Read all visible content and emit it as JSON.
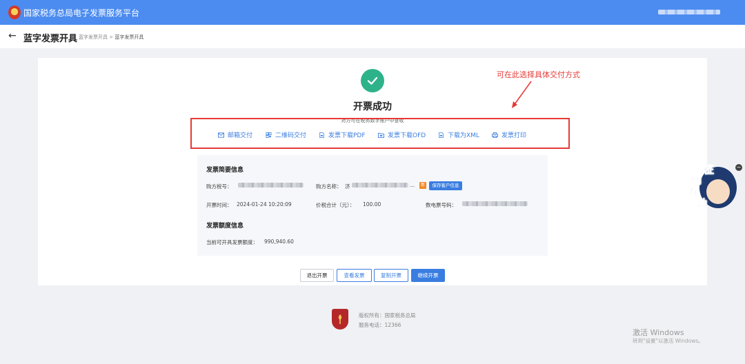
{
  "header": {
    "app_title": "国家税务总局电子发票服务平台"
  },
  "page": {
    "back_icon": "arrow-left-icon",
    "title": "蓝字发票开具",
    "breadcrumb": [
      "蓝字发票开具",
      "蓝字发票开具"
    ],
    "breadcrumb_sep": ">"
  },
  "result": {
    "title": "开票成功",
    "subtitle": "对方可在税务数字账户中查收",
    "icon": "check-circle-icon",
    "icon_color": "#2eb28a"
  },
  "annotation": {
    "text": "可在此选择具体交付方式",
    "color": "#e53935"
  },
  "delivery_options": [
    {
      "label": "邮箱交付",
      "icon": "mail-icon"
    },
    {
      "label": "二维码交付",
      "icon": "qrcode-icon"
    },
    {
      "label": "发票下载PDF",
      "icon": "file-pdf-icon"
    },
    {
      "label": "发票下载OFD",
      "icon": "file-ofd-icon"
    },
    {
      "label": "下载为XML",
      "icon": "file-xml-icon"
    },
    {
      "label": "发票打印",
      "icon": "printer-icon"
    }
  ],
  "invoice_summary": {
    "section_title": "发票简要信息",
    "buyer_tax_id_label": "购方税号：",
    "buyer_name_label": "购方名称：",
    "buyer_name_prefix": "济",
    "buyer_name_suffix": "...",
    "new_tag": "新",
    "save_customer_label": "保存客户信息",
    "issue_time_label": "开票时间：",
    "issue_time_value": "2024-01-24 10:20:09",
    "total_label": "价税合计（元）：",
    "total_value": "100.00",
    "invoice_no_label": "数电票号码："
  },
  "quota": {
    "section_title": "发票额度信息",
    "available_label": "当前可开具发票额度：",
    "available_value": "990,940.60"
  },
  "actions": {
    "exit": "退出开票",
    "view": "查看发票",
    "copy": "复制开票",
    "continue": "继续开票"
  },
  "footer": {
    "copyright": "版权所有：国家税务总局",
    "phone": "服务电话：12366"
  },
  "mascot": {
    "chars": [
      "征",
      "纳",
      "互",
      "动"
    ],
    "close": "−"
  },
  "watermark": {
    "line1": "激活 Windows",
    "line2": "转到\"设置\"以激活 Windows。"
  },
  "colors": {
    "brand_blue": "#4c8cf0",
    "link_blue": "#3a7de0",
    "success_green": "#2eb28a",
    "alert_red": "#e53935"
  }
}
